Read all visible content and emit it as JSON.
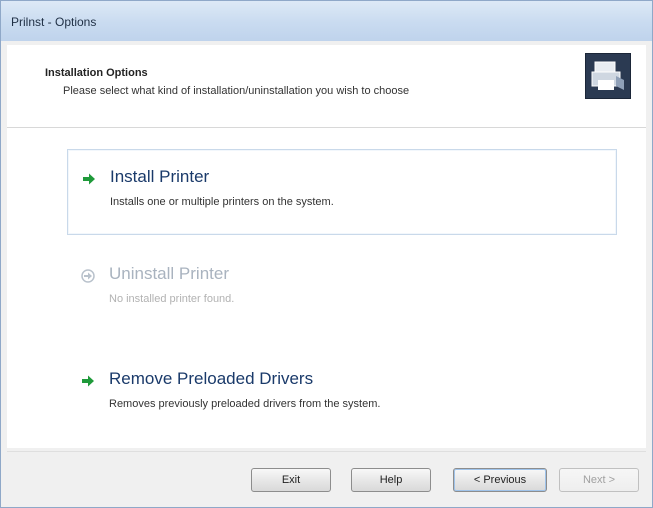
{
  "window": {
    "title": "Prilnst - Options"
  },
  "header": {
    "title": "Installation Options",
    "subtitle": "Please select what kind of installation/uninstallation you wish to choose"
  },
  "options": [
    {
      "title": "Install Printer",
      "description": "Installs one or multiple printers on the system.",
      "icon": "green-arrow-icon",
      "enabled": true,
      "selected": true
    },
    {
      "title": "Uninstall Printer",
      "description": "No installed printer found.",
      "icon": "disabled-arrow-icon",
      "enabled": false,
      "selected": false
    },
    {
      "title": "Remove Preloaded Drivers",
      "description": "Removes previously preloaded drivers from the system.",
      "icon": "green-arrow-icon",
      "enabled": true,
      "selected": false
    }
  ],
  "buttons": {
    "exit": "Exit",
    "help": "Help",
    "previous": "< Previous",
    "next": "Next >"
  },
  "colors": {
    "accent_arrow": "#1f9a3a",
    "disabled_arrow": "#b9c2cc"
  }
}
